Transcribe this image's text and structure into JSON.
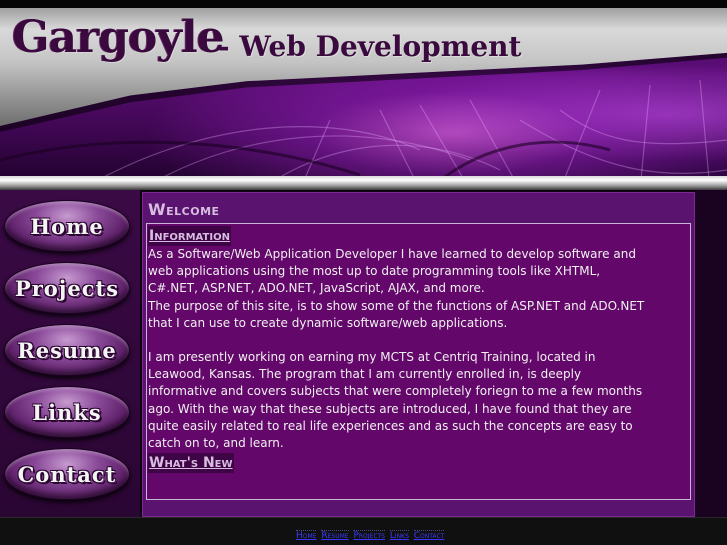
{
  "header": {
    "title": "Gargoyle",
    "subtitle": "- Web Development"
  },
  "nav": {
    "items": [
      {
        "label": "Home"
      },
      {
        "label": "Projects"
      },
      {
        "label": "Resume"
      },
      {
        "label": "Links"
      },
      {
        "label": "Contact"
      }
    ]
  },
  "main": {
    "heading": "Welcome",
    "sections": [
      {
        "title": "Information",
        "paragraphs": [
          "As a Software/Web Application Developer I have learned to develop software and web applications using the most up to date programming tools like XHTML, C#.NET, ASP.NET, ADO.NET, JavaScript, AJAX, and more.",
          "The purpose of this site, is to show some of the functions of ASP.NET and ADO.NET that I can use to create dynamic software/web applications.",
          "I am presently working on earning my MCTS at Centriq Training, located in Leawood, Kansas. The program that I am currently enrolled in, is deeply informative and covers subjects that were completely foriegn to me a few months ago. With the way that these subjects are introduced, I have found that they are quite easily related to real life experiences and as such the concepts are easy to catch on to, and learn."
        ]
      },
      {
        "title": "What's New",
        "paragraphs": []
      }
    ]
  },
  "footer": {
    "links": [
      "Home",
      "Resume",
      "Projects",
      "Links",
      "Contact"
    ]
  },
  "colors": {
    "accent": "#64076b",
    "nav_button": "#8a4a99",
    "footer_link": "#3a3aff"
  }
}
